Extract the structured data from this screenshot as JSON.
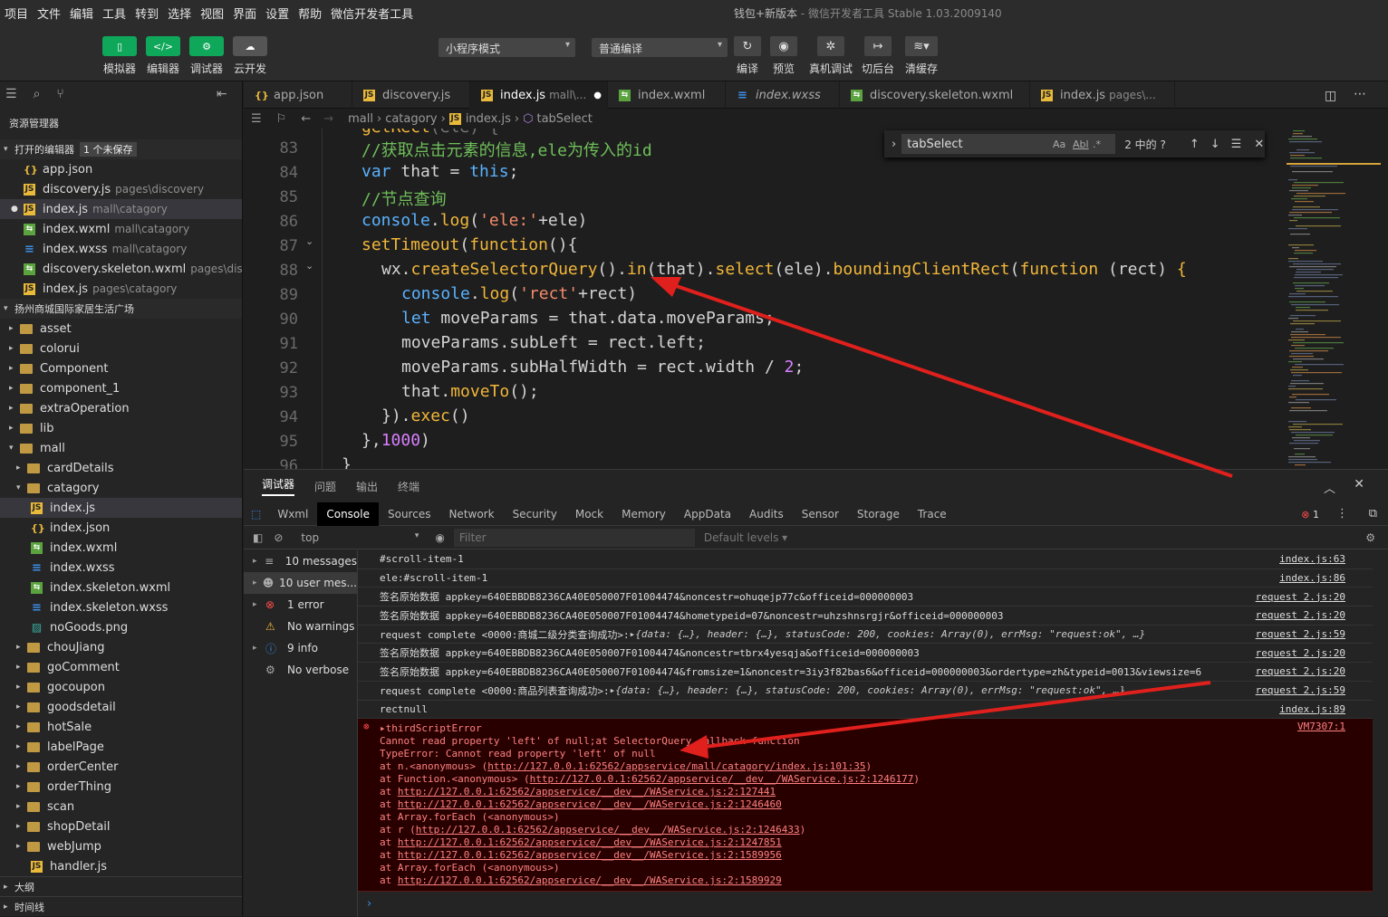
{
  "menu": [
    "项目",
    "文件",
    "编辑",
    "工具",
    "转到",
    "选择",
    "视图",
    "界面",
    "设置",
    "帮助",
    "微信开发者工具"
  ],
  "window_title": {
    "main": "钱包+新版本",
    "sub": " - 微信开发者工具 Stable 1.03.2009140"
  },
  "toolbar": {
    "simulator": "模拟器",
    "editor": "编辑器",
    "debugger": "调试器",
    "cloud": "云开发",
    "mode_select": "小程序模式",
    "compile_select": "普通编译",
    "compile": "编译",
    "preview": "预览",
    "real_debug": "真机调试",
    "background": "切后台",
    "clear_cache": "清缓存"
  },
  "sidebar": {
    "title": "资源管理器",
    "open_editors": "打开的编辑器",
    "unsaved": "1 个未保存",
    "open_files": [
      {
        "name": "app.json",
        "path": "",
        "type": "json"
      },
      {
        "name": "discovery.js",
        "path": "pages\\discovery",
        "type": "js"
      },
      {
        "name": "index.js",
        "path": "mall\\catagory",
        "type": "js"
      },
      {
        "name": "index.wxml",
        "path": "mall\\catagory",
        "type": "wxml"
      },
      {
        "name": "index.wxss",
        "path": "mall\\catagory",
        "type": "wxss"
      },
      {
        "name": "discovery.skeleton.wxml",
        "path": "pages\\dis...",
        "type": "wxml"
      },
      {
        "name": "index.js",
        "path": "pages\\catagory",
        "type": "js"
      }
    ],
    "project": "扬州商城国际家居生活广场",
    "folders1": [
      "asset",
      "colorui",
      "Component",
      "component_1",
      "extraOperation",
      "lib"
    ],
    "mall": "mall",
    "cardDetails": "cardDetails",
    "catagory": "catagory",
    "catagory_files": [
      {
        "name": "index.js",
        "type": "js"
      },
      {
        "name": "index.json",
        "type": "json"
      },
      {
        "name": "index.wxml",
        "type": "wxml"
      },
      {
        "name": "index.wxss",
        "type": "wxss"
      },
      {
        "name": "index.skeleton.wxml",
        "type": "wxml"
      },
      {
        "name": "index.skeleton.wxss",
        "type": "wxss"
      },
      {
        "name": "noGoods.png",
        "type": "png"
      }
    ],
    "folders2": [
      "chouJiang",
      "goComment",
      "gocoupon",
      "goodsdetail",
      "hotSale",
      "labelPage",
      "orderCenter",
      "orderThing",
      "scan",
      "shopDetail",
      "webJump"
    ],
    "handler": "handler.js",
    "outline": "大纲",
    "timeline": "时间线"
  },
  "tabs": [
    {
      "name": "app.json",
      "path": "",
      "type": "json"
    },
    {
      "name": "discovery.js",
      "path": "",
      "type": "js"
    },
    {
      "name": "index.js",
      "path": "mall\\...",
      "type": "js"
    },
    {
      "name": "index.wxml",
      "path": "",
      "type": "wxml"
    },
    {
      "name": "index.wxss",
      "path": "",
      "type": "wxss"
    },
    {
      "name": "discovery.skeleton.wxml",
      "path": "",
      "type": "wxml"
    },
    {
      "name": "index.js",
      "path": "pages\\...",
      "type": "js"
    }
  ],
  "breadcrumb": {
    "a": "mall",
    "b": "catagory",
    "c": "index.js",
    "d": "tabSelect"
  },
  "find": {
    "value": "tabSelect",
    "aa": "Aa",
    "ab": "Abl",
    "re": ".*",
    "count": "2 中的 ?"
  },
  "editor": {
    "lines": [
      "83",
      "84",
      "85",
      "86",
      "87",
      "88",
      "89",
      "90",
      "91",
      "92",
      "93",
      "94",
      "95",
      "96"
    ]
  },
  "devtools": {
    "top_tabs": [
      "调试器",
      "问题",
      "输出",
      "终端"
    ],
    "panels": [
      "Wxml",
      "Console",
      "Sources",
      "Network",
      "Security",
      "Mock",
      "Memory",
      "AppData",
      "Audits",
      "Sensor",
      "Storage",
      "Trace"
    ],
    "context": "top",
    "filter_placeholder": "Filter",
    "levels": "Default levels",
    "err_count": "1",
    "side": [
      "10 messages",
      "10 user mes...",
      "1 error",
      "No warnings",
      "9 info",
      "No verbose"
    ],
    "logs": [
      {
        "text": "#scroll-item-1",
        "src": "index.js:63"
      },
      {
        "text": "ele:#scroll-item-1",
        "src": "index.js:86"
      },
      {
        "text": "签名原始数据 appkey=640EBBDB8236CA40E050007F01004474&noncestr=ohuqejp77c&officeid=000000003",
        "src": "request 2.js:20"
      },
      {
        "text": "签名原始数据 appkey=640EBBDB8236CA40E050007F01004474&hometypeid=07&noncestr=uhzshnsrgjr&officeid=000000003",
        "src": "request 2.js:20"
      },
      {
        "text": "request complete <0000:商城二级分类查询成功>: ",
        "obj": "▸{data: {…}, header: {…}, statusCode: 200, cookies: Array(0), errMsg: \"request:ok\", …}",
        "src": "request 2.js:59"
      },
      {
        "text": "签名原始数据 appkey=640EBBDB8236CA40E050007F01004474&noncestr=tbrx4yesqja&officeid=000000003",
        "src": "request 2.js:20"
      },
      {
        "text": "签名原始数据 appkey=640EBBDB8236CA40E050007F01004474&fromsize=1&noncestr=3iy3f82bas6&officeid=000000003&ordertype=zh&typeid=0013&viewsize=6",
        "src": "request 2.js:20"
      },
      {
        "text": "request complete <0000:商品列表查询成功>: ",
        "obj": "▸{data: {…}, header: {…}, statusCode: 200, cookies: Array(0), errMsg: \"request:ok\", …}",
        "src": "request 2.js:59"
      },
      {
        "text": "rectnull",
        "src": "index.js:89"
      }
    ],
    "error": {
      "title": "▸thirdScriptError",
      "src": "VM7307:1",
      "lines": [
        "Cannot read property 'left' of null;at SelectorQuery callback function",
        "TypeError: Cannot read property 'left' of null"
      ],
      "stack": [
        [
          "    at n.<anonymous> (",
          "http://127.0.0.1:62562/appservice/mall/catagory/index.js:101:35",
          ")"
        ],
        [
          "    at Function.<anonymous> (",
          "http://127.0.0.1:62562/appservice/__dev__/WAService.js:2:1246177",
          ")"
        ],
        [
          "    at ",
          "http://127.0.0.1:62562/appservice/__dev__/WAService.js:2:127441",
          ""
        ],
        [
          "    at ",
          "http://127.0.0.1:62562/appservice/__dev__/WAService.js:2:1246460",
          ""
        ],
        [
          "    at Array.forEach (<anonymous>)",
          "",
          ""
        ],
        [
          "    at r (",
          "http://127.0.0.1:62562/appservice/__dev__/WAService.js:2:1246433",
          ")"
        ],
        [
          "    at ",
          "http://127.0.0.1:62562/appservice/__dev__/WAService.js:2:1247851",
          ""
        ],
        [
          "    at ",
          "http://127.0.0.1:62562/appservice/__dev__/WAService.js:2:1589956",
          ""
        ],
        [
          "    at Array.forEach (<anonymous>)",
          "",
          ""
        ],
        [
          "    at ",
          "http://127.0.0.1:62562/appservice/__dev__/WAService.js:2:1589929",
          ""
        ]
      ]
    }
  },
  "colors": {
    "accent_green": "#0fa85a",
    "error_red": "#ff4d4d",
    "arrow": "#e0201c"
  }
}
